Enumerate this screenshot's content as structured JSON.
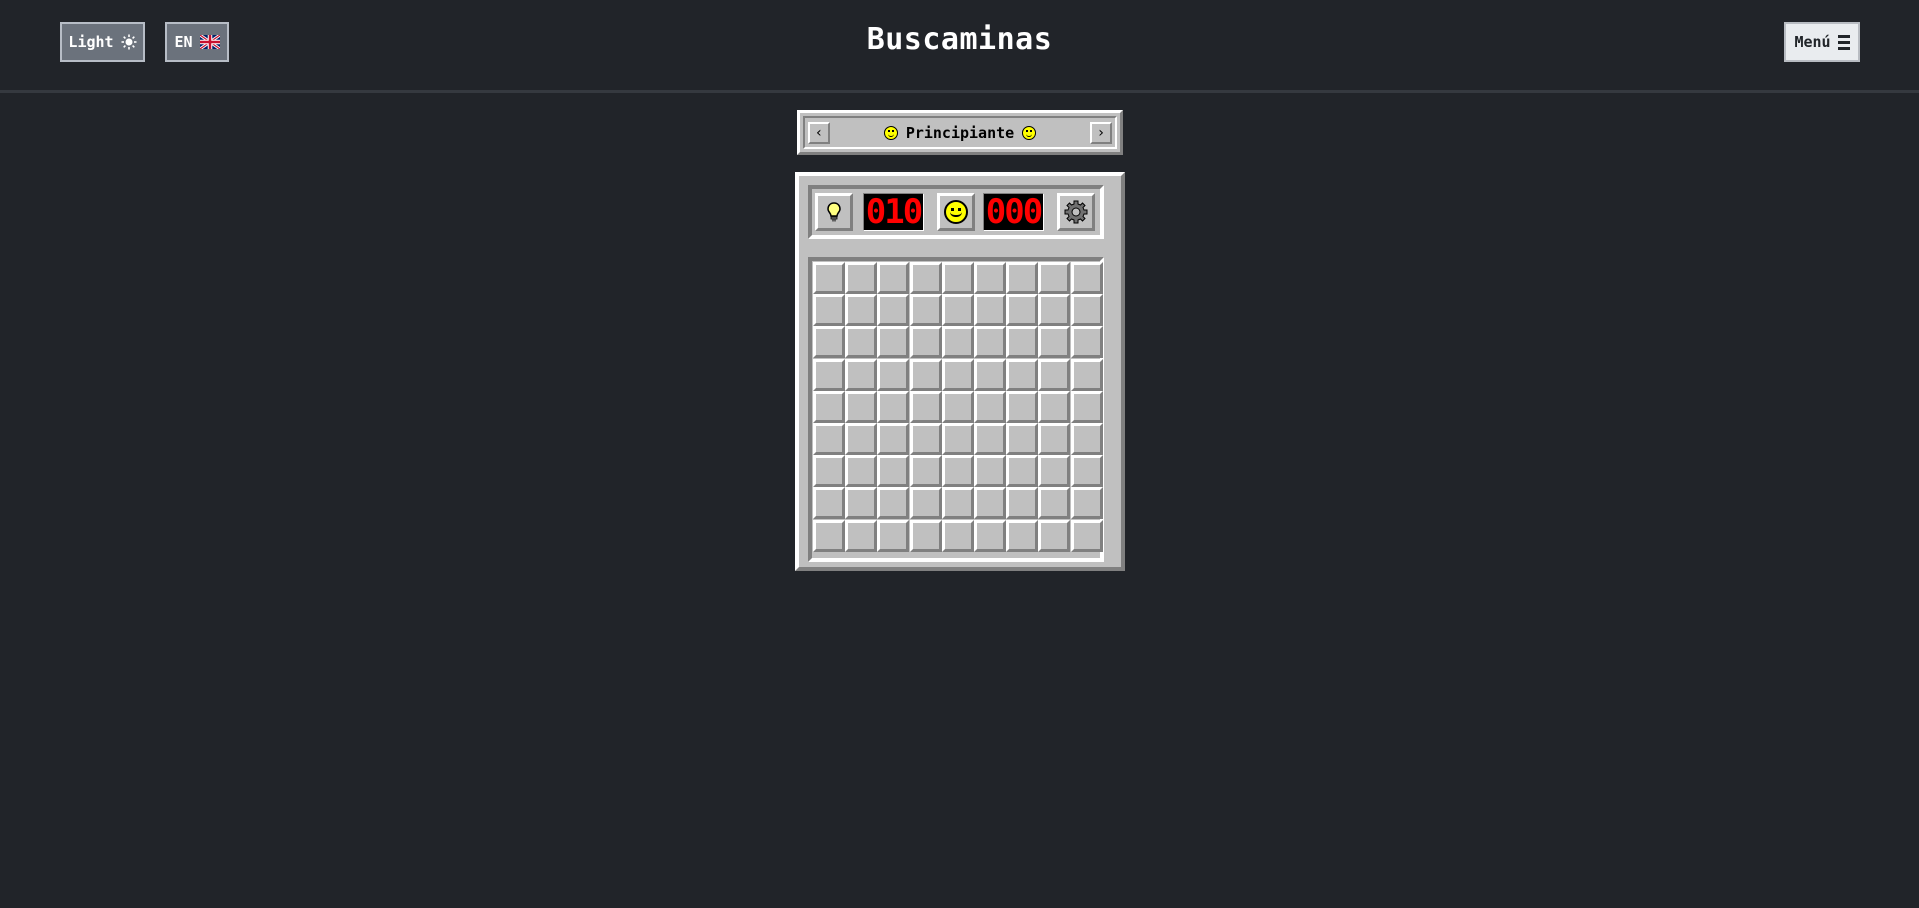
{
  "header": {
    "title": "Buscaminas",
    "theme_button_label": "Light",
    "theme_icon": "sun-icon",
    "language_button_label": "EN",
    "language_icon": "uk-flag-icon",
    "menu_button_label": "Menú",
    "menu_icon": "hamburger-icon"
  },
  "difficulty": {
    "label": "Principiante",
    "prev_symbol": "‹",
    "next_symbol": "›",
    "icon": "smiley-icon"
  },
  "game": {
    "mines_counter": "010",
    "timer": "000",
    "hint_icon": "lightbulb-icon",
    "face_icon": "smiley-face-icon",
    "settings_icon": "gear-icon",
    "rows": 9,
    "cols": 9,
    "cell_state": "hidden"
  },
  "colors": {
    "background": "#212429",
    "panel": "#c0c0c0",
    "counter_digits": "#ff0000",
    "smiley": "#ffff00"
  }
}
